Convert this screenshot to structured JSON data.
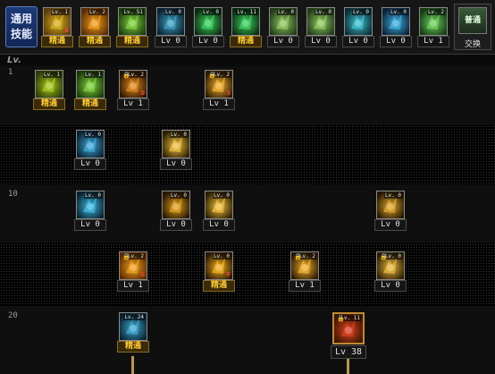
{
  "colors": {
    "frame": "#8a8a8a",
    "master_bg": "#3a2a08",
    "master_text": "#ffcc33",
    "tab_bg": "#1c3b78"
  },
  "tab": {
    "line1": "通用",
    "line2": "技能"
  },
  "level_header": "Lv.",
  "swap_button": {
    "icon_text": "普通",
    "label": "交换"
  },
  "quickbar": [
    {
      "icon": "scroll-icon",
      "lvtag": "Lv. 1",
      "caption": "精通",
      "master": true,
      "sub": "A",
      "colors": [
        "#d8b020",
        "#5a3a08"
      ]
    },
    {
      "icon": "flame-fist-icon",
      "lvtag": "Lv. 2",
      "caption": "精通",
      "master": true,
      "sub": "",
      "colors": [
        "#f0a020",
        "#5a2a00"
      ]
    },
    {
      "icon": "green-tablet-icon",
      "lvtag": "Lv. 51",
      "caption": "精通",
      "master": true,
      "sub": "",
      "colors": [
        "#80d040",
        "#1a3a0a"
      ]
    },
    {
      "icon": "winged-orb-icon",
      "lvtag": "Lv. 0",
      "caption": "Lv 0",
      "master": false,
      "sub": "",
      "colors": [
        "#40a0c0",
        "#0a2030"
      ]
    },
    {
      "icon": "green-target-icon",
      "lvtag": "Lv. 0",
      "caption": "Lv 0",
      "master": false,
      "sub": "",
      "colors": [
        "#40d060",
        "#082a10"
      ]
    },
    {
      "icon": "green-target-icon",
      "lvtag": "Lv. 11",
      "caption": "精通",
      "master": true,
      "sub": "",
      "colors": [
        "#40d060",
        "#082a10"
      ]
    },
    {
      "icon": "green-figure-icon",
      "lvtag": "Lv. 0",
      "caption": "Lv 0",
      "master": false,
      "sub": "",
      "colors": [
        "#90c860",
        "#203a18"
      ]
    },
    {
      "icon": "green-figure-icon",
      "lvtag": "Lv. 0",
      "caption": "Lv 0",
      "master": false,
      "sub": "",
      "colors": [
        "#90c860",
        "#203a18"
      ]
    },
    {
      "icon": "cyan-disc-icon",
      "lvtag": "Lv. 0",
      "caption": "Lv 0",
      "master": false,
      "sub": "",
      "colors": [
        "#40c0d0",
        "#0a2a30"
      ]
    },
    {
      "icon": "cyan-body-icon",
      "lvtag": "Lv. 0",
      "caption": "Lv 0",
      "master": false,
      "sub": "",
      "colors": [
        "#40b0e0",
        "#0a2035"
      ]
    },
    {
      "icon": "green-rune-icon",
      "lvtag": "Lv. 2",
      "caption": "Lv 1",
      "master": false,
      "sub": "",
      "colors": [
        "#70d060",
        "#123a12"
      ]
    }
  ],
  "row_labels": [
    "1",
    "10",
    "20"
  ],
  "tree": [
    {
      "name": "skill-scroll-node",
      "icon": "scroll-icon",
      "lvtag": "Lv. 1",
      "caption": "精通",
      "master": true,
      "lock": false,
      "sub": "",
      "colors": [
        "#a8c820",
        "#2a3a08"
      ]
    },
    {
      "name": "skill-tablet-node",
      "icon": "green-tablet-icon",
      "lvtag": "Lv. 1",
      "caption": "精通",
      "master": true,
      "lock": false,
      "sub": "",
      "colors": [
        "#80d040",
        "#1a3a0a"
      ]
    },
    {
      "name": "skill-flame-slash-d-node",
      "icon": "flame-slash-icon",
      "lvtag": "Lv. 2",
      "caption": "Lv 1",
      "master": false,
      "lock": true,
      "sub": "D",
      "colors": [
        "#e08a20",
        "#2a1400"
      ]
    },
    {
      "name": "skill-flame-slash-s-node",
      "icon": "flame-slash-icon",
      "lvtag": "Lv. 2",
      "caption": "Lv 1",
      "master": false,
      "lock": true,
      "sub": "S",
      "colors": [
        "#f0b030",
        "#2a1800"
      ]
    },
    {
      "name": "skill-cyan-hand-node",
      "icon": "cyan-hand-icon",
      "lvtag": "Lv. 0",
      "caption": "Lv 0",
      "master": false,
      "lock": false,
      "sub": "",
      "colors": [
        "#40a8d8",
        "#08202e"
      ]
    },
    {
      "name": "skill-spark-node",
      "icon": "spark-icon",
      "lvtag": "Lv. 0",
      "caption": "Lv 0",
      "master": false,
      "lock": false,
      "sub": "",
      "colors": [
        "#f0c040",
        "#2a1e00"
      ]
    },
    {
      "name": "skill-cyan-strike-node",
      "icon": "cyan-strike-icon",
      "lvtag": "Lv. 0",
      "caption": "Lv 0",
      "master": false,
      "lock": false,
      "sub": "",
      "colors": [
        "#40b8e0",
        "#082230"
      ]
    },
    {
      "name": "skill-gold-claw-node",
      "icon": "gold-claw-icon",
      "lvtag": "Lv. 0",
      "caption": "Lv 0",
      "master": false,
      "lock": false,
      "sub": "",
      "colors": [
        "#e0a020",
        "#261400"
      ]
    },
    {
      "name": "skill-gold-burst-node",
      "icon": "gold-burst-icon",
      "lvtag": "Lv. 0",
      "caption": "Lv 0",
      "master": false,
      "lock": false,
      "sub": "",
      "colors": [
        "#f0c040",
        "#2a1e00"
      ]
    },
    {
      "name": "skill-gold-beast-node",
      "icon": "gold-beast-icon",
      "lvtag": "Lv. 0",
      "caption": "Lv 0",
      "master": false,
      "lock": false,
      "sub": "",
      "colors": [
        "#e0a830",
        "#241600"
      ]
    },
    {
      "name": "skill-fire-pillar-node",
      "icon": "fire-pillar-icon",
      "lvtag": "Lv. 2",
      "caption": "Lv 1",
      "master": false,
      "lock": true,
      "sub": "G",
      "colors": [
        "#f0a020",
        "#2a1200"
      ]
    },
    {
      "name": "skill-fire-dash-node",
      "icon": "fire-dash-icon",
      "lvtag": "Lv. 0",
      "caption": "精通",
      "master": true,
      "lock": false,
      "sub": "F",
      "colors": [
        "#f0b020",
        "#2a1600"
      ]
    },
    {
      "name": "skill-fire-orb-node",
      "icon": "fire-orb-icon",
      "lvtag": "Lv. 2",
      "caption": "Lv 1",
      "master": false,
      "lock": true,
      "sub": "",
      "colors": [
        "#f0b030",
        "#2a1600"
      ]
    },
    {
      "name": "skill-gold-crown-node",
      "icon": "gold-crown-icon",
      "lvtag": "Lv. 0",
      "caption": "Lv 0",
      "master": false,
      "lock": true,
      "sub": "",
      "colors": [
        "#e8b840",
        "#2a1c00"
      ]
    },
    {
      "name": "skill-cyan-fist-node",
      "icon": "cyan-fist-icon",
      "lvtag": "Lv. 24",
      "caption": "精通",
      "master": true,
      "lock": false,
      "sub": "",
      "colors": [
        "#40a8d0",
        "#08202e"
      ]
    },
    {
      "name": "skill-ultimate-node",
      "icon": "red-gold-awaken-icon",
      "lvtag": "Lv. 11",
      "caption": "Lv 38",
      "master": false,
      "lock": true,
      "sub": "",
      "colors": [
        "#d84020",
        "#3a1600"
      ]
    }
  ]
}
